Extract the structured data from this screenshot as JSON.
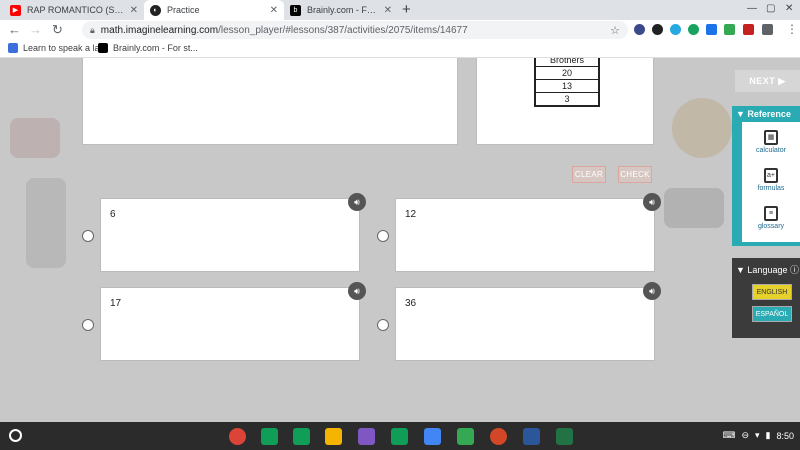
{
  "tabs": [
    {
      "title": "RAP ROMANTICO (Signo Rap, M...",
      "favicon": "youtube-icon",
      "color": "#ff0000"
    },
    {
      "title": "Practice",
      "favicon": "imagine-learning-icon",
      "color": "#222222"
    },
    {
      "title": "Brainly.com - For students. By st...",
      "favicon": "brainly-icon",
      "color": "#000000"
    }
  ],
  "address": {
    "host": "math.imaginelearning.com",
    "path": "/lesson_player/#lessons/387/activities/2075/items/14677"
  },
  "bookmarks": [
    {
      "label": "Learn to speak a la...",
      "icon": "duolingo-icon"
    },
    {
      "label": "Brainly.com - For st...",
      "icon": "brainly-icon"
    }
  ],
  "table": {
    "header": "Brothers",
    "rows": [
      "20",
      "13",
      "3"
    ]
  },
  "controls": {
    "clear": "CLEAR",
    "check": "CHECK",
    "next": "NEXT ▶"
  },
  "answers": [
    "6",
    "12",
    "17",
    "36"
  ],
  "reference": {
    "title": "Reference",
    "items": [
      "calculator",
      "formulas",
      "glossary"
    ]
  },
  "language": {
    "title": "Language",
    "options": [
      "ENGLISH",
      "ESPAÑOL"
    ]
  },
  "shelf": {
    "time": "8:50"
  },
  "colors": {
    "accent_teal": "#2aaab2",
    "english_yellow": "#e6d12a",
    "espanol_teal": "#2aaab2"
  }
}
